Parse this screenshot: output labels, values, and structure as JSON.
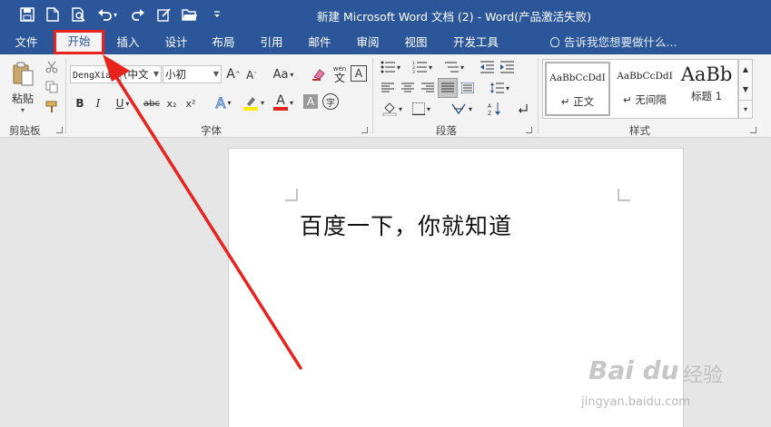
{
  "window": {
    "title": "新建 Microsoft Word 文档 (2) - Word(产品激活失败)"
  },
  "tabs": [
    {
      "label": "文件"
    },
    {
      "label": "开始"
    },
    {
      "label": "插入"
    },
    {
      "label": "设计"
    },
    {
      "label": "布局"
    },
    {
      "label": "引用"
    },
    {
      "label": "邮件"
    },
    {
      "label": "审阅"
    },
    {
      "label": "视图"
    },
    {
      "label": "开发工具"
    }
  ],
  "tell_me": "告诉我您想要做什么...",
  "clipboard": {
    "paste_label": "粘贴",
    "group_label": "剪贴板"
  },
  "font": {
    "font_name": "DengXian",
    "font_script": "(中文",
    "font_size": "小初",
    "grow": "A",
    "shrink": "A",
    "case": "Aa",
    "phonetic": "wén",
    "phonetic_char": "文",
    "border_char": "A",
    "bold": "B",
    "italic": "I",
    "underline": "U",
    "strike": "abc",
    "subscript": "x₂",
    "superscript": "x²",
    "text_effects": "A",
    "font_color": "A",
    "shading": "A",
    "enclose": "字",
    "group_label": "字体"
  },
  "paragraph": {
    "group_label": "段落"
  },
  "styles": {
    "items": [
      {
        "sample": "AaBbCcDdI",
        "name": "↵ 正文"
      },
      {
        "sample": "AaBbCcDdI",
        "name": "↵ 无间隔"
      },
      {
        "sample": "AaBb",
        "name": "标题 1"
      }
    ],
    "group_label": "样式"
  },
  "document": {
    "text": "百度一下，你就知道"
  },
  "watermark": {
    "brand": "Bai du",
    "cn": "经验",
    "url": "jingyan.baidu.com"
  },
  "colors": {
    "title_bar": "#2b579a",
    "ribbon": "#f3f3f3",
    "highlight": "#e8221d"
  }
}
